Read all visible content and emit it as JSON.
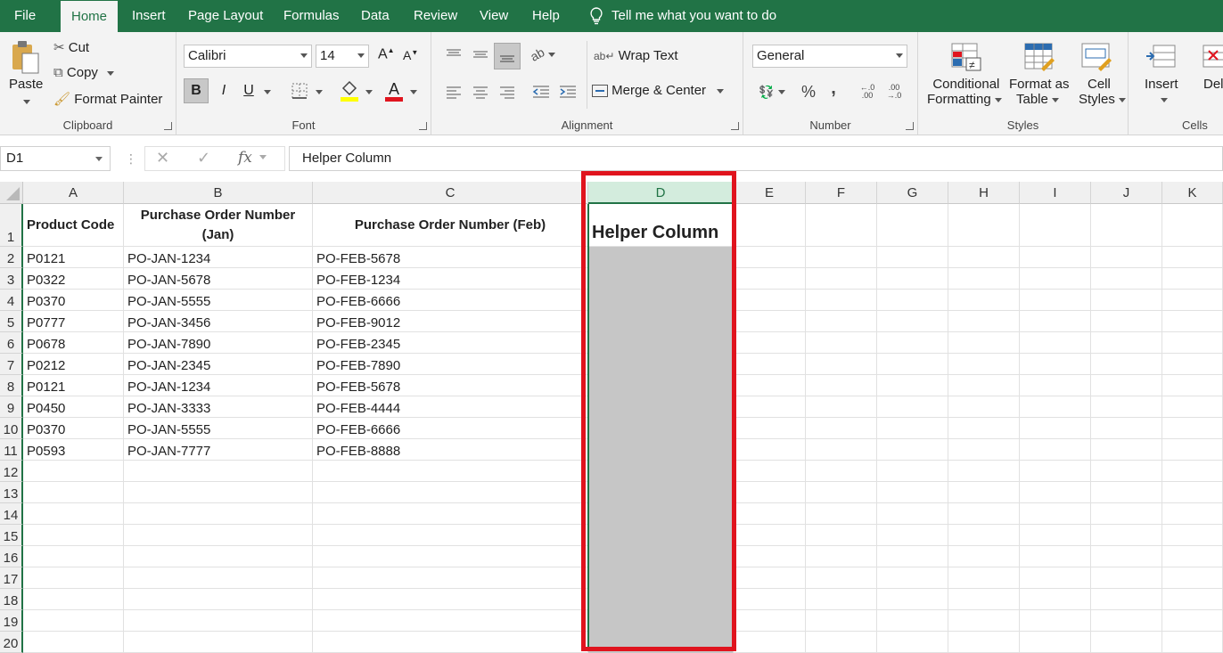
{
  "menu": {
    "tabs": [
      "File",
      "Home",
      "Insert",
      "Page Layout",
      "Formulas",
      "Data",
      "Review",
      "View",
      "Help"
    ],
    "active": "Home",
    "tell_me": "Tell me what you want to do"
  },
  "ribbon": {
    "clipboard": {
      "paste": "Paste",
      "cut": "Cut",
      "copy": "Copy",
      "format_painter": "Format Painter",
      "label": "Clipboard"
    },
    "font": {
      "name": "Calibri",
      "size": "14",
      "bold": "B",
      "italic": "I",
      "underline": "U",
      "font_color_glyph": "A",
      "label": "Font"
    },
    "alignment": {
      "wrap_text": "Wrap Text",
      "merge_center": "Merge & Center",
      "label": "Alignment"
    },
    "number": {
      "format": "General",
      "percent": "%",
      "comma": ",",
      "label": "Number"
    },
    "styles": {
      "conditional_1": "Conditional",
      "conditional_2": "Formatting",
      "format_table_1": "Format as",
      "format_table_2": "Table",
      "cell_styles_1": "Cell",
      "cell_styles_2": "Styles",
      "label": "Styles"
    },
    "cells": {
      "insert": "Insert",
      "delete": "Delete",
      "label": "Cells"
    }
  },
  "formula_bar": {
    "name_box": "D1",
    "fx": "fx",
    "content": "Helper Column"
  },
  "columns": [
    "A",
    "B",
    "C",
    "D",
    "E",
    "F",
    "G",
    "H",
    "I",
    "J",
    "K"
  ],
  "rows": [
    "1",
    "2",
    "3",
    "4",
    "5",
    "6",
    "7",
    "8",
    "9",
    "10",
    "11",
    "12",
    "13",
    "14",
    "15",
    "16",
    "17",
    "18",
    "19",
    "20"
  ],
  "headers": {
    "a": "Product Code",
    "b": "Purchase Order Number (Jan)",
    "c": "Purchase Order Number (Feb)",
    "d": "Helper Column"
  },
  "table": [
    [
      "P0121",
      "PO-JAN-1234",
      "PO-FEB-5678"
    ],
    [
      "P0322",
      "PO-JAN-5678",
      "PO-FEB-1234"
    ],
    [
      "P0370",
      "PO-JAN-5555",
      "PO-FEB-6666"
    ],
    [
      "P0777",
      "PO-JAN-3456",
      "PO-FEB-9012"
    ],
    [
      "P0678",
      "PO-JAN-7890",
      "PO-FEB-2345"
    ],
    [
      "P0212",
      "PO-JAN-2345",
      "PO-FEB-7890"
    ],
    [
      "P0121",
      "PO-JAN-1234",
      "PO-FEB-5678"
    ],
    [
      "P0450",
      "PO-JAN-3333",
      "PO-FEB-4444"
    ],
    [
      "P0370",
      "PO-JAN-5555",
      "PO-FEB-6666"
    ],
    [
      "P0593",
      "PO-JAN-7777",
      "PO-FEB-8888"
    ]
  ],
  "colors": {
    "excel_green": "#217346",
    "highlight_red": "#e0141e",
    "helper_fill": "#c6c6c6"
  }
}
